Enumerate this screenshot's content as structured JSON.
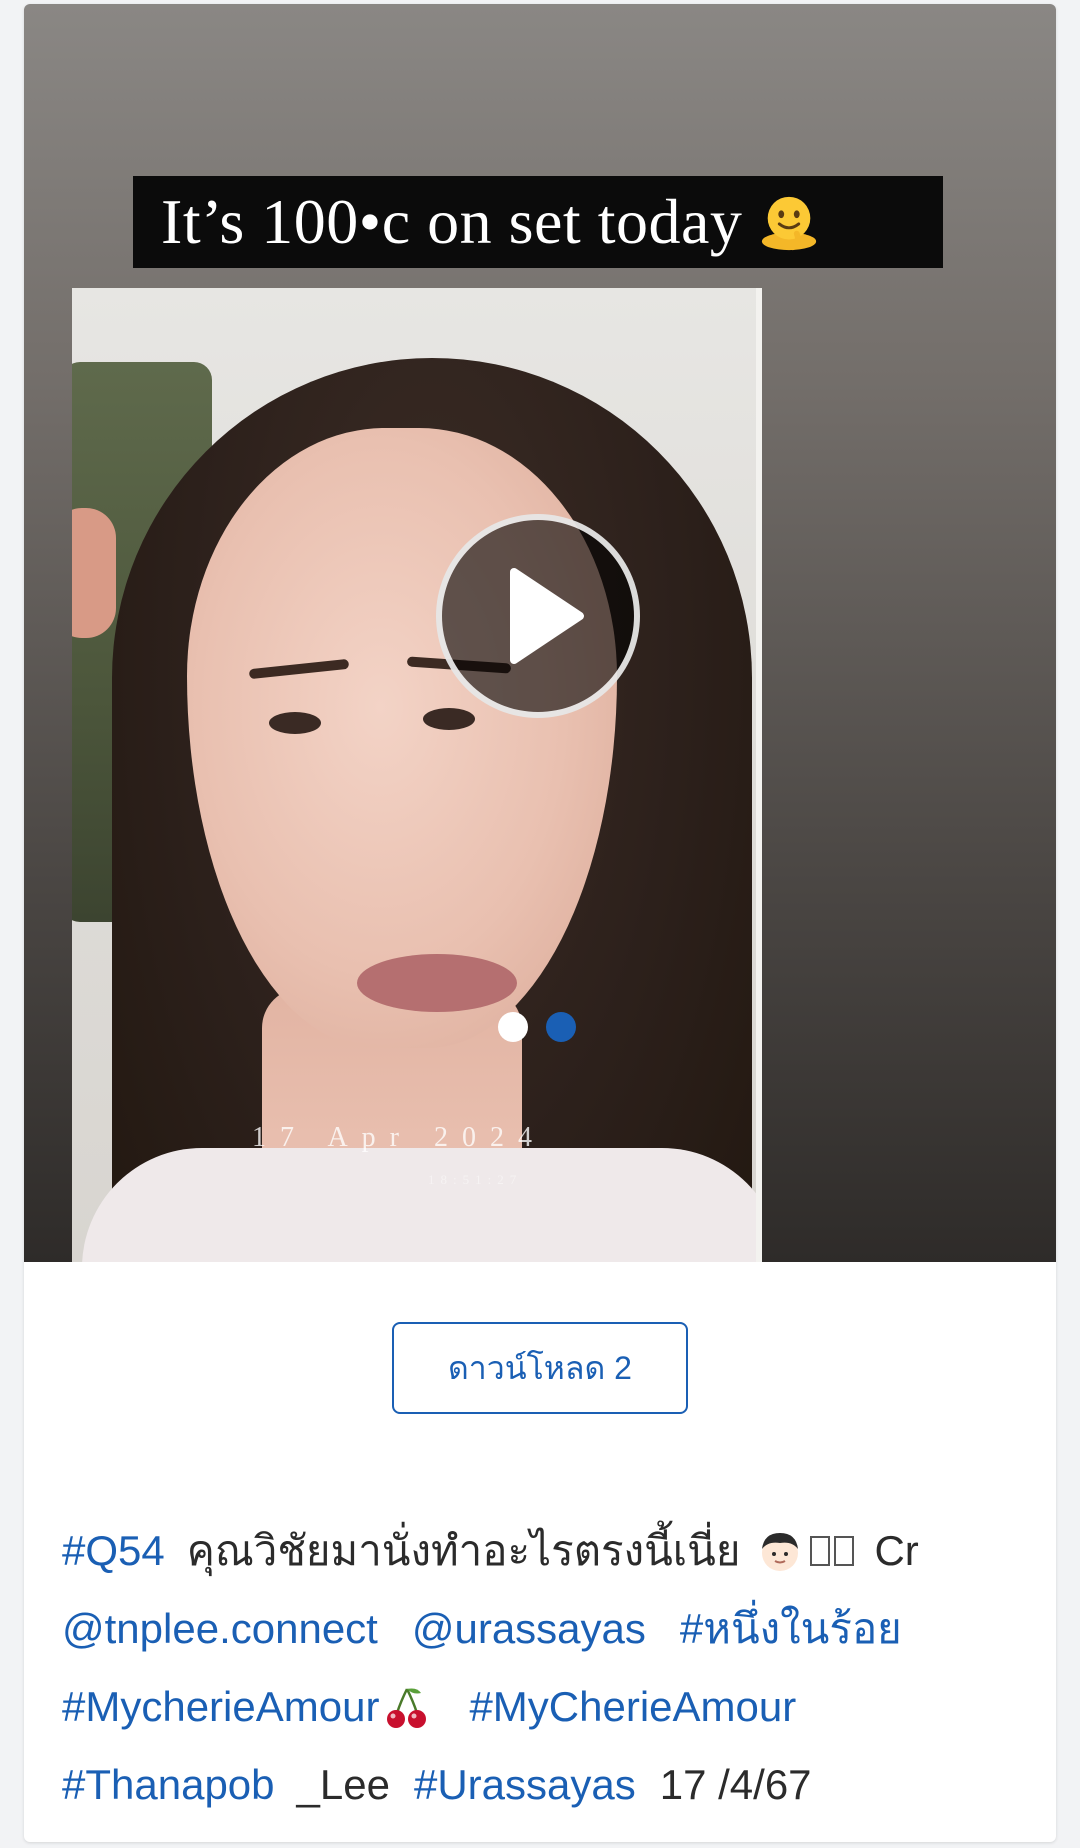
{
  "story": {
    "caption": "It’s 100•c on set today",
    "caption_emoji": "melting-face-emoji",
    "photo_date": "17 Apr 2024",
    "photo_time": "18:51:27"
  },
  "carousel": {
    "count": 2,
    "active_index": 1,
    "dot_inactive_color": "#ffffff",
    "dot_active_color": "#1a5fb4"
  },
  "download": {
    "label": "ดาวน์โหลด 2"
  },
  "post": {
    "hashtag_q54": "#Q54",
    "text_main": "คุณวิชัยมานั่งทำอะไรตรงนี้เนี่ย",
    "cr": "Cr",
    "mention_tnplee": "@tnplee.connect",
    "mention_urassayas": "@urassayas",
    "hashtag_one_in_hundred": "#หนึ่งในร้อย",
    "hashtag_mycherie_lower": "#MycherieAmour",
    "hashtag_mycherie_upper": "#MyCherieAmour",
    "hashtag_thanapob": "#Thanapob",
    "text_lee": "_Lee",
    "hashtag_urassayas": "#Urassayas",
    "date": "17 /4/67"
  },
  "colors": {
    "link": "#1a5fb4",
    "text": "#2b2b2b"
  }
}
